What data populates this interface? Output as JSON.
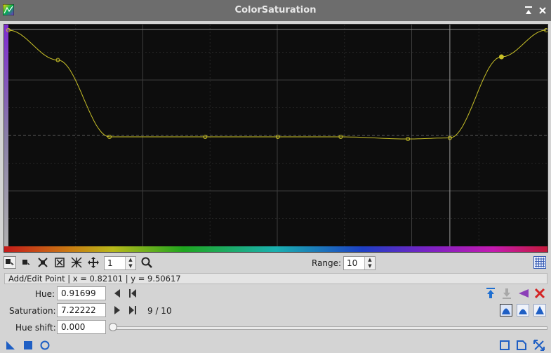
{
  "window": {
    "title": "ColorSaturation"
  },
  "curve": {
    "points": [
      {
        "x": 0.0,
        "y": 1.0
      },
      {
        "x": 0.092,
        "y": 0.72
      },
      {
        "x": 0.188,
        "y": 0.0
      },
      {
        "x": 0.366,
        "y": 0.0
      },
      {
        "x": 0.501,
        "y": 0.0
      },
      {
        "x": 0.618,
        "y": 0.0
      },
      {
        "x": 0.743,
        "y": -0.02
      },
      {
        "x": 0.82101,
        "y": -0.01
      },
      {
        "x": 0.91699,
        "y": 0.75
      },
      {
        "x": 1.0,
        "y": 1.0
      }
    ],
    "selected_index": 8,
    "curve_color": "#c9c128",
    "cursor_line_x": 0.82101
  },
  "toolbar": {
    "zoom_value": "1",
    "range_label": "Range:",
    "range_value": "10"
  },
  "status": {
    "text": "Add/Edit Point | x = 0.82101 | y = 9.50617"
  },
  "fields": {
    "hue_label": "Hue:",
    "hue_value": "0.91699",
    "saturation_label": "Saturation:",
    "saturation_value": "7.22222",
    "point_counter": "9 / 10",
    "hue_shift_label": "Hue shift:",
    "hue_shift_value": "0.000"
  },
  "icons": {
    "window_close": "close-icon",
    "window_shade": "shade-icon",
    "delete_point": "delete-icon"
  }
}
